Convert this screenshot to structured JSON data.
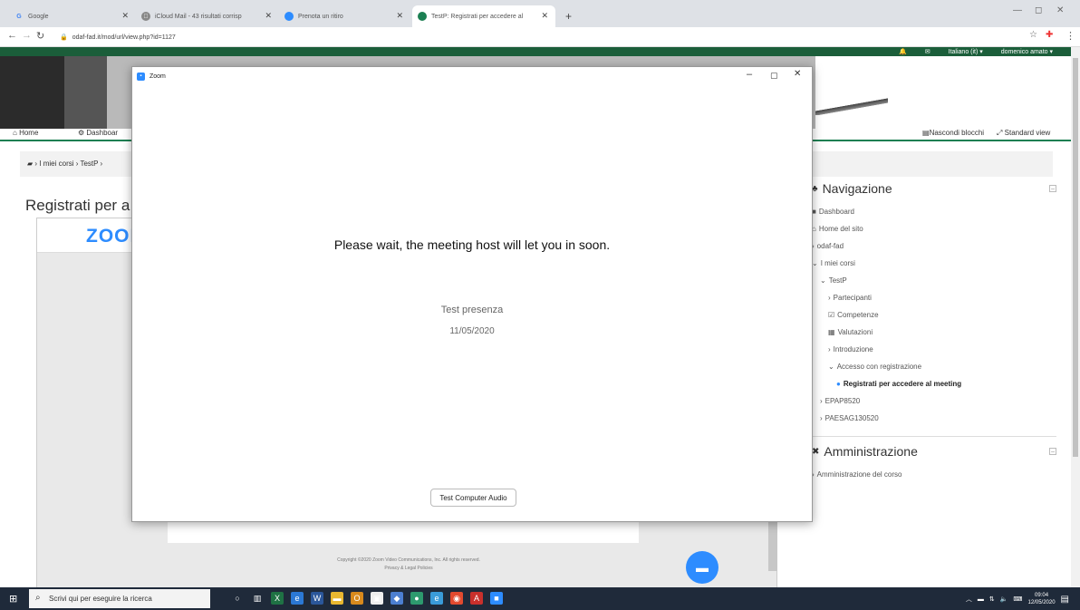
{
  "browser": {
    "tabs": [
      {
        "title": "Google",
        "favicon": "G",
        "color": "#4285f4"
      },
      {
        "title": "iCloud Mail - 43 risultati corrisp",
        "favicon": "",
        "color": "#666666"
      },
      {
        "title": "Prenota un ritiro",
        "favicon": "●",
        "color": "#2d8cff"
      },
      {
        "title": "TestP: Registrati per accedere al",
        "favicon": "●",
        "color": "#1b7f52"
      }
    ],
    "new_tab": "+",
    "url": "odaf-fad.it/mod/url/view.php?id=1127"
  },
  "moodle": {
    "top_language": "Italiano (it) ▾",
    "top_user": "domenico amato ▾",
    "nav_home": "Home",
    "nav_dashboard": "Dashboar",
    "nav_hide_blocks": "Nascondi blocchi",
    "nav_standard_view": "Standard view",
    "breadcrumb": "› I miei corsi › TestP ›",
    "page_title": "Registrati per a",
    "zoom_logo": "ZOOI",
    "copyright_line1": "Copyright ©2020 Zoom Video Communications, Inc. All rights reserved.",
    "copyright_line2": "Privacy & Legal Policies"
  },
  "sidebar": {
    "navigation_title": "Navigazione",
    "nav_items": [
      {
        "label": "Dashboard",
        "prefix": "■",
        "indent": 0
      },
      {
        "label": "Home del sito",
        "prefix": "⌂",
        "indent": 0
      },
      {
        "label": "odaf-fad",
        "prefix": "›",
        "indent": 0
      },
      {
        "label": "I miei corsi",
        "prefix": "⌄",
        "indent": 0
      },
      {
        "label": "TestP",
        "prefix": "⌄",
        "indent": 1
      },
      {
        "label": "Partecipanti",
        "prefix": "›",
        "indent": 2
      },
      {
        "label": "Competenze",
        "prefix": "☑",
        "indent": 2
      },
      {
        "label": "Valutazioni",
        "prefix": "▦",
        "indent": 2
      },
      {
        "label": "Introduzione",
        "prefix": "›",
        "indent": 2
      },
      {
        "label": "Accesso con registrazione",
        "prefix": "⌄",
        "indent": 2
      },
      {
        "label": "Registrati per accedere al meeting",
        "prefix": "●",
        "indent": 3
      },
      {
        "label": "EPAP8520",
        "prefix": "›",
        "indent": 1
      },
      {
        "label": "PAESAG130520",
        "prefix": "›",
        "indent": 1
      }
    ],
    "admin_title": "Amministrazione",
    "admin_items": [
      {
        "label": "Amministrazione del corso",
        "prefix": "›"
      }
    ]
  },
  "zoom_window": {
    "title": "Zoom",
    "wait_message": "Please wait, the meeting host will let you in soon.",
    "meeting_topic": "Test presenza",
    "meeting_date": "11/05/2020",
    "test_audio_label": "Test Computer Audio"
  },
  "taskbar": {
    "search_placeholder": "Scrivi qui per eseguire la ricerca",
    "time": "09:04",
    "date": "12/05/2020",
    "apps": [
      {
        "name": "cortana-icon",
        "glyph": "○",
        "color": "transparent"
      },
      {
        "name": "task-view-icon",
        "glyph": "▥",
        "color": "transparent"
      },
      {
        "name": "excel-icon",
        "glyph": "X",
        "color": "#1f7244"
      },
      {
        "name": "edge-icon",
        "glyph": "e",
        "color": "#2b78d4"
      },
      {
        "name": "word-icon",
        "glyph": "W",
        "color": "#2b579a"
      },
      {
        "name": "explorer-icon",
        "glyph": "▬",
        "color": "#e8b730"
      },
      {
        "name": "outlook-icon",
        "glyph": "O",
        "color": "#d88a1d"
      },
      {
        "name": "store-icon",
        "glyph": "▣",
        "color": "#eeeeee"
      },
      {
        "name": "photos-icon",
        "glyph": "◆",
        "color": "#4c7fd1"
      },
      {
        "name": "maps-icon",
        "glyph": "●",
        "color": "#2d9a6e"
      },
      {
        "name": "ie-icon",
        "glyph": "e",
        "color": "#3a9bd9"
      },
      {
        "name": "chrome-icon",
        "glyph": "◉",
        "color": "#e24a2f"
      },
      {
        "name": "acrobat-icon",
        "glyph": "A",
        "color": "#c9302c"
      },
      {
        "name": "zoom-icon",
        "glyph": "■",
        "color": "#2d8cff"
      }
    ]
  }
}
